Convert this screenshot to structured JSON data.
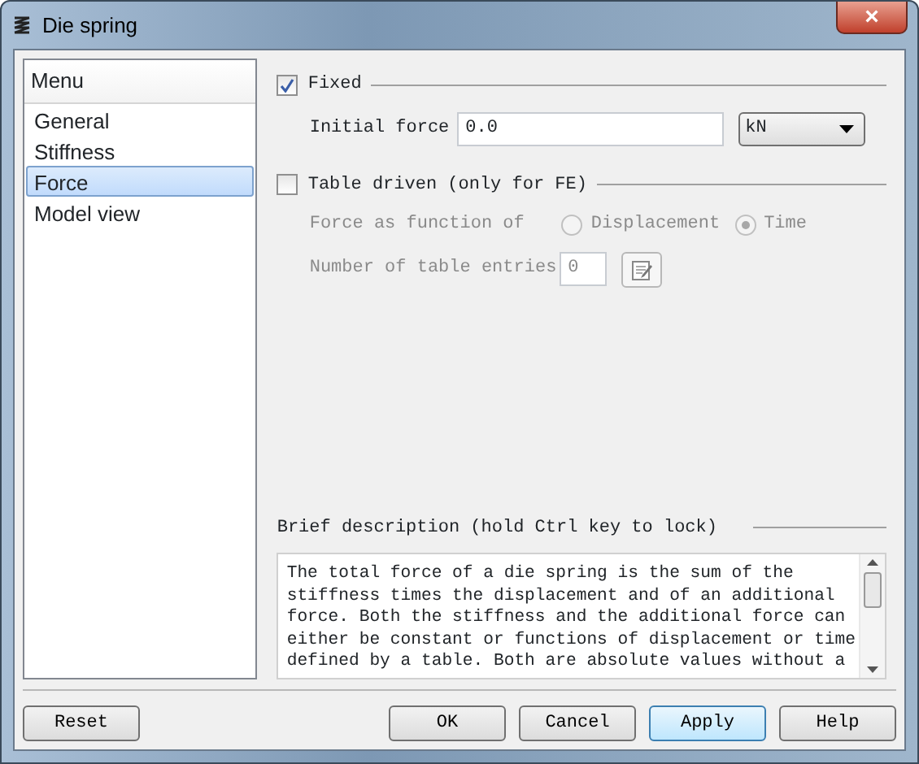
{
  "window": {
    "title": "Die spring",
    "close": "×"
  },
  "sidebar": {
    "header": "Menu",
    "items": [
      {
        "label": "General",
        "selected": false
      },
      {
        "label": "Stiffness",
        "selected": false
      },
      {
        "label": "Force",
        "selected": true
      },
      {
        "label": "Model view",
        "selected": false
      }
    ]
  },
  "fixed": {
    "label": "Fixed",
    "checked": true
  },
  "initial_force": {
    "label": "Initial force",
    "value": "0.0",
    "unit": "kN"
  },
  "table_driven": {
    "label": "Table driven (only for FE)",
    "checked": false
  },
  "function_of": {
    "label": "Force as function of",
    "disabled": true,
    "options": [
      {
        "label": "Displacement",
        "selected": false
      },
      {
        "label": "Time",
        "selected": true
      }
    ]
  },
  "table_entries": {
    "label": "Number of table entries",
    "value": "0",
    "disabled": true
  },
  "description": {
    "title": "Brief description (hold Ctrl key to lock)",
    "lines": [
      "The total force of a die spring is the sum of the",
      "stiffness times the displacement and of an additional",
      "force. Both the stiffness and the additional force can",
      "either be constant or functions of displacement or time",
      "defined by a table. Both are absolute values without a"
    ]
  },
  "buttons": [
    {
      "label": "Reset",
      "default": false
    },
    {
      "label": "OK",
      "default": false
    },
    {
      "label": "Cancel",
      "default": false
    },
    {
      "label": "Apply",
      "default": true
    },
    {
      "label": "Help",
      "default": false
    }
  ]
}
